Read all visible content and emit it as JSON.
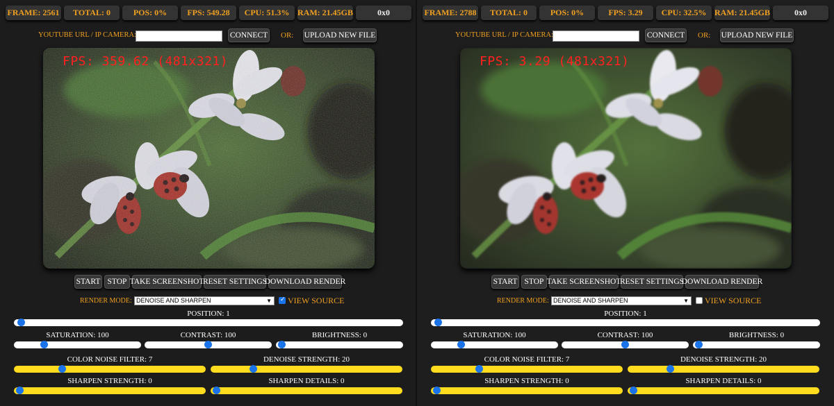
{
  "panels": [
    {
      "id": "left",
      "stats": {
        "frame": "FRAME: 2561",
        "total": "TOTAL: 0",
        "pos": "POS: 0%",
        "fps": "FPS: 549.28",
        "cpu": "CPU: 51.3%",
        "ram": "RAM: 21.45GB",
        "size": "0x0"
      },
      "url": {
        "label": "YOUTUBE URL / IP CAMERA:",
        "value": "",
        "placeholder": ""
      },
      "connect": "CONNECT",
      "or": "OR:",
      "upload": "UPLOAD NEW FILE",
      "fps_overlay": "FPS: 359.62 (481x321)",
      "video_style": "noisy",
      "controls": {
        "start": "START",
        "stop": "STOP",
        "screenshot": "TAKE SCREENSHOT",
        "reset": "RESET SETTINGS",
        "download": "DOWNLOAD RENDER"
      },
      "render_mode": {
        "label": "RENDER MODE:",
        "value": "DENOISE AND SHARPEN"
      },
      "view_source": {
        "label": "VIEW SOURCE",
        "checked": true
      },
      "sliders": {
        "position": {
          "label": "POSITION: 1",
          "fraction": 0.01
        },
        "saturation": {
          "label": "SATURATION: 100",
          "fraction": 0.22
        },
        "contrast": {
          "label": "CONTRAST: 100",
          "fraction": 0.5
        },
        "brightness": {
          "label": "BRIGHTNESS: 0",
          "fraction": 0.02
        },
        "color_noise": {
          "label": "COLOR NOISE FILTER: 7",
          "fraction": 0.24
        },
        "denoise": {
          "label": "DENOISE STRENGTH: 20",
          "fraction": 0.21
        },
        "sharpen_strength": {
          "label": "SHARPEN STRENGTH: 0",
          "fraction": 0.01
        },
        "sharpen_details": {
          "label": "SHARPEN DETAILS: 0",
          "fraction": 0.01
        }
      }
    },
    {
      "id": "right",
      "stats": {
        "frame": "FRAME: 2788",
        "total": "TOTAL: 0",
        "pos": "POS: 0%",
        "fps": "FPS: 3.29",
        "cpu": "CPU: 32.5%",
        "ram": "RAM: 21.45GB",
        "size": "0x0"
      },
      "url": {
        "label": "YOUTUBE URL / IP CAMERA:",
        "value": "",
        "placeholder": ""
      },
      "connect": "CONNECT",
      "or": "OR:",
      "upload": "UPLOAD NEW FILE",
      "fps_overlay": "FPS: 3.29 (481x321)",
      "video_style": "clean",
      "controls": {
        "start": "START",
        "stop": "STOP",
        "screenshot": "TAKE SCREENSHOT",
        "reset": "RESET SETTINGS",
        "download": "DOWNLOAD RENDER"
      },
      "render_mode": {
        "label": "RENDER MODE:",
        "value": "DENOISE AND SHARPEN"
      },
      "view_source": {
        "label": "VIEW SOURCE",
        "checked": false
      },
      "sliders": {
        "position": {
          "label": "POSITION: 1",
          "fraction": 0.01
        },
        "saturation": {
          "label": "SATURATION: 100",
          "fraction": 0.22
        },
        "contrast": {
          "label": "CONTRAST: 100",
          "fraction": 0.5
        },
        "brightness": {
          "label": "BRIGHTNESS: 0",
          "fraction": 0.02
        },
        "color_noise": {
          "label": "COLOR NOISE FILTER: 7",
          "fraction": 0.24
        },
        "denoise": {
          "label": "DENOISE STRENGTH: 20",
          "fraction": 0.21
        },
        "sharpen_strength": {
          "label": "SHARPEN STRENGTH: 0",
          "fraction": 0.01
        },
        "sharpen_details": {
          "label": "SHARPEN DETAILS: 0",
          "fraction": 0.01
        }
      }
    }
  ],
  "colors": {
    "accent": "#f0a020",
    "thumb": "#1a73e8",
    "yellow_track": "#ffdc1e",
    "fps_overlay": "#ff2020"
  }
}
